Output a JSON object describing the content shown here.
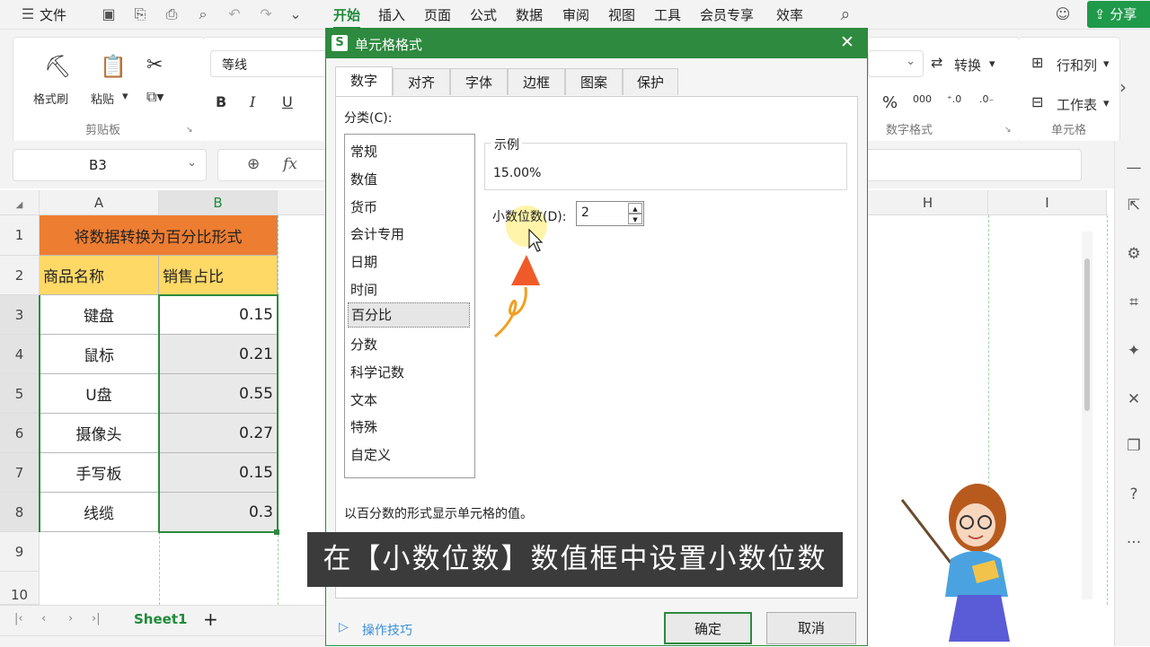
{
  "menu": {
    "file": "文件",
    "tabs": [
      "开始",
      "插入",
      "页面",
      "公式",
      "数据",
      "审阅",
      "视图",
      "工具",
      "会员专享",
      "效率"
    ],
    "active": "开始",
    "share": "分享"
  },
  "ribbon": {
    "format_painter": "格式刷",
    "paste": "粘贴",
    "clipboard_group": "剪贴板",
    "font_name": "等线",
    "bold": "B",
    "italic": "I",
    "underline": "U",
    "convert": "转换",
    "row_col": "行和列",
    "worksheet": "工作表",
    "number_format_group": "数字格式",
    "cells_group": "单元格",
    "percent_symbol": "%",
    "thousands_symbol": "000"
  },
  "formula_bar": {
    "name_box": "B3",
    "fx": "fx"
  },
  "grid": {
    "columns": [
      "A",
      "B",
      "H",
      "I"
    ],
    "rows": [
      "1",
      "2",
      "3",
      "4",
      "5",
      "6",
      "7",
      "8",
      "9",
      "10"
    ],
    "title_cell": "将数据转换为百分比形式",
    "header_a": "商品名称",
    "header_b": "销售占比",
    "data": [
      {
        "name": "键盘",
        "value": "0.15"
      },
      {
        "name": "鼠标",
        "value": "0.21"
      },
      {
        "name": "U盘",
        "value": "0.55"
      },
      {
        "name": "摄像头",
        "value": "0.27"
      },
      {
        "name": "手写板",
        "value": "0.15"
      },
      {
        "name": "线缆",
        "value": "0.3"
      }
    ],
    "title_color": "#ed7d31",
    "header_color": "#ffd966"
  },
  "sheet_tabs": {
    "sheet1": "Sheet1",
    "add": "+"
  },
  "dialog": {
    "title": "单元格格式",
    "tabs": [
      "数字",
      "对齐",
      "字体",
      "边框",
      "图案",
      "保护"
    ],
    "category_label": "分类(C):",
    "categories": [
      "常规",
      "数值",
      "货币",
      "会计专用",
      "日期",
      "时间",
      "百分比",
      "分数",
      "科学记数",
      "文本",
      "特殊",
      "自定义"
    ],
    "selected_category": "百分比",
    "sample_label": "示例",
    "sample_value": "15.00%",
    "decimal_label": "小数位数(D):",
    "decimal_value": "2",
    "description": "以百分数的形式显示单元格的值。",
    "tips_link": "操作技巧",
    "ok": "确定",
    "cancel": "取消",
    "accent": "#2d8a3e"
  },
  "caption": "在【小数位数】数值框中设置小数位数"
}
